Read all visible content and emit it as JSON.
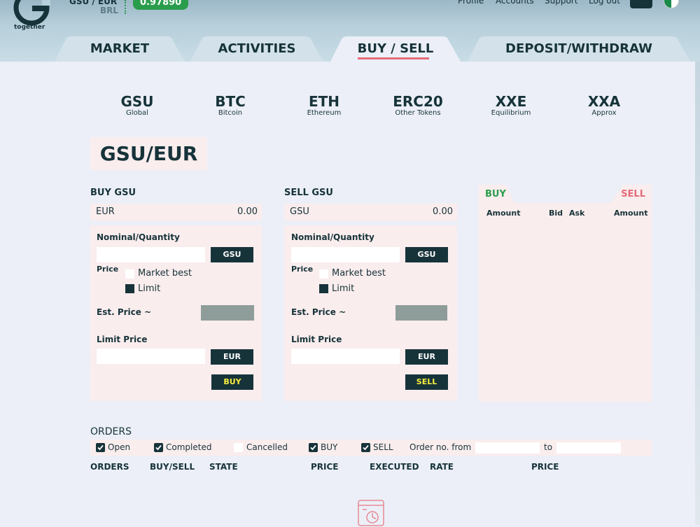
{
  "header": {
    "logo_text": "together",
    "pair_primary": "GSU / EUR",
    "pair_secondary": "BRL",
    "rate": "0.97890",
    "nav": [
      "Profile",
      "Accounts",
      "Support",
      "Log out"
    ]
  },
  "tabs": [
    {
      "label": "MARKET"
    },
    {
      "label": "ACTIVITIES"
    },
    {
      "label": "BUY / SELL"
    },
    {
      "label": "DEPOSIT/WITHDRAW"
    }
  ],
  "coins": [
    {
      "symbol": "GSU",
      "name": "Global"
    },
    {
      "symbol": "BTC",
      "name": "Bitcoin"
    },
    {
      "symbol": "ETH",
      "name": "Ethereum"
    },
    {
      "symbol": "ERC20",
      "name": "Other Tokens"
    },
    {
      "symbol": "XXE",
      "name": "Equilibrium"
    },
    {
      "symbol": "XXA",
      "name": "Approx"
    }
  ],
  "pair_title": "GSU/EUR",
  "buy": {
    "title": "BUY GSU",
    "balance_currency": "EUR",
    "balance_amount": "0.00",
    "nominal_label": "Nominal/Quantity",
    "qty_unit": "GSU",
    "price_label": "Price",
    "market_best": "Market best",
    "limit": "Limit",
    "est_price": "Est. Price ~",
    "limit_price": "Limit Price",
    "price_unit": "EUR",
    "action": "BUY"
  },
  "sell": {
    "title": "SELL GSU",
    "balance_currency": "GSU",
    "balance_amount": "0.00",
    "nominal_label": "Nominal/Quantity",
    "qty_unit": "GSU",
    "price_label": "Price",
    "market_best": "Market best",
    "limit": "Limit",
    "est_price": "Est. Price ~",
    "limit_price": "Limit Price",
    "price_unit": "EUR",
    "action": "SELL"
  },
  "orderbook": {
    "buy_label": "BUY",
    "sell_label": "SELL",
    "columns": [
      "Amount",
      "Bid",
      "Ask",
      "Amount"
    ]
  },
  "orders": {
    "title": "ORDERS",
    "filters": {
      "open": "Open",
      "completed": "Completed",
      "cancelled": "Cancelled",
      "buy": "BUY",
      "sell": "SELL",
      "order_from": "Order no. from",
      "to": "to"
    },
    "columns": [
      "ORDERS",
      "BUY/SELL",
      "STATE",
      "PRICE",
      "EXECUTED",
      "RATE",
      "PRICE"
    ]
  },
  "colors": {
    "primary": "#17333a",
    "accent_green": "#2a9d4c",
    "accent_red": "#e36b78",
    "panel_bg": "#faeded"
  }
}
